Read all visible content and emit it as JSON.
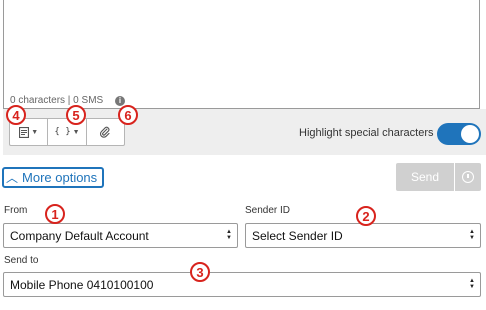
{
  "message": {
    "counter_text": "0 characters | 0 SMS",
    "info_icon": "info-icon",
    "info_glyph": "i"
  },
  "toolbar": {
    "template_icon": "template-icon",
    "personalize_icon": "curly-braces-icon",
    "personalize_glyph": "{ }",
    "attachment_icon": "paperclip-icon",
    "highlight_label": "Highlight special characters",
    "highlight_on": true
  },
  "more_options": {
    "label": "More options"
  },
  "send": {
    "label": "Send",
    "schedule_icon": "clock-icon"
  },
  "form": {
    "from_label": "From",
    "from_value": "Company Default Account",
    "sender_label": "Sender ID",
    "sender_value": "Select Sender ID",
    "sendto_label": "Send to",
    "sendto_value": "Mobile Phone 0410100100"
  },
  "markers": [
    "1",
    "2",
    "3",
    "4",
    "5",
    "6"
  ],
  "colors": {
    "accent": "#1f74bb",
    "marker": "#d8231d",
    "disabled": "#d0d0d0"
  }
}
